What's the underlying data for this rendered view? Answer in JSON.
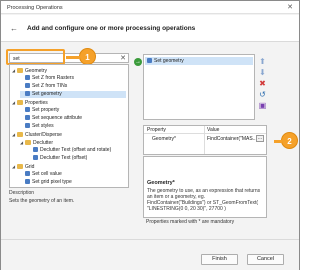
{
  "window": {
    "title": "Processing Operations",
    "close_glyph": "✕"
  },
  "header": {
    "back_glyph": "←",
    "title": "Add and configure one or more processing operations"
  },
  "search": {
    "value": "set",
    "clear_glyph": "✕"
  },
  "callouts": [
    "1",
    "2"
  ],
  "tree": {
    "items": [
      {
        "label": "Geometry",
        "expander": "◢",
        "icon": "folder-icon"
      },
      {
        "label": "Set Z from Rasters",
        "icon": "operation-icon"
      },
      {
        "label": "Set Z from TINs",
        "icon": "operation-icon"
      },
      {
        "label": "Set geometry",
        "icon": "operation-icon",
        "selected": true
      },
      {
        "label": "Properties",
        "expander": "◢",
        "icon": "folder-icon"
      },
      {
        "label": "Set property",
        "icon": "operation-icon"
      },
      {
        "label": "Set sequence attribute",
        "icon": "operation-icon"
      },
      {
        "label": "Set styles",
        "icon": "operation-icon"
      },
      {
        "label": "Cluster/Disperse",
        "expander": "◢",
        "icon": "folder-icon"
      },
      {
        "label": "Declutter",
        "expander": "◢",
        "icon": "folder-icon"
      },
      {
        "label": "Declutter Text (offset and rotate)",
        "icon": "operation-icon"
      },
      {
        "label": "Declutter Text (offset)",
        "icon": "operation-icon"
      },
      {
        "label": "Grid",
        "expander": "◢",
        "icon": "folder-icon"
      },
      {
        "label": "Set cell value",
        "icon": "operation-icon"
      },
      {
        "label": "Set grid pixel type",
        "icon": "operation-icon"
      }
    ]
  },
  "description": {
    "label": "Description",
    "text": "Sets the geometry of an item."
  },
  "add_button": {
    "glyph": "→",
    "icon": "add-arrow-icon",
    "color": "#3b9b3b"
  },
  "selected_operations": [
    {
      "label": "Set geometry"
    }
  ],
  "side_buttons": [
    {
      "glyph": "⬆",
      "icon": "move-up-icon"
    },
    {
      "glyph": "⬇",
      "icon": "move-down-icon"
    },
    {
      "glyph": "✖",
      "icon": "remove-icon"
    },
    {
      "glyph": "↺",
      "icon": "reset-icon"
    },
    {
      "glyph": "▣",
      "icon": "save-icon"
    }
  ],
  "properties": {
    "headers": {
      "property": "Property",
      "value": "Value"
    },
    "row": {
      "name": "Geometry*",
      "value": "FindContainer(\"MAS...",
      "button": "..."
    }
  },
  "help": {
    "title": "Geometry*",
    "body": "The geometry to use, as an expression that returns an item or a geometry, eg. FindContainer(\"Buildings\") or ST_GeomFromText( \"LINESTRING(0 0, 20 30)\", 27700 )"
  },
  "mandatory_note": "Properties marked with * are mandatory",
  "footer": {
    "finish": "Finish",
    "cancel": "Cancel"
  },
  "colors": {
    "accent": "#f5a12a",
    "selection": "#cfe3f7"
  }
}
